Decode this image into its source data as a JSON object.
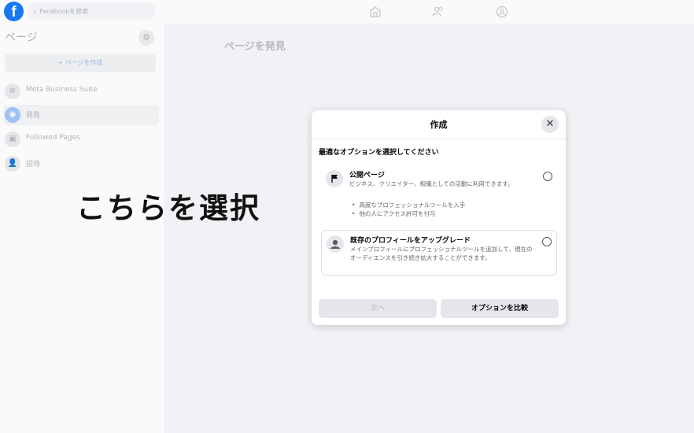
{
  "topbar": {
    "search_placeholder": "Facebookを検索"
  },
  "sidebar": {
    "title": "ページ",
    "create_label": "+ ページを作成",
    "items": [
      {
        "label": "Meta Business Suite",
        "icon": "meta-business-icon"
      },
      {
        "label": "発見",
        "icon": "compass-icon"
      },
      {
        "label": "Followed Pages",
        "icon": "like-icon"
      },
      {
        "label": "招待",
        "icon": "invite-icon"
      }
    ]
  },
  "main": {
    "title": "ページを発見"
  },
  "annotation": {
    "text": "こちらを選択"
  },
  "dialog": {
    "title": "作成",
    "close_icon": "close-icon",
    "subtitle": "最適なオプションを選択してください",
    "options": [
      {
        "title": "公開ページ",
        "description": "ビジネス、クリエイター、組織としての活動に利用できます。",
        "bullets": [
          "高度なプロフェッショナルツールを入手",
          "他の人にアクセス許可を付与"
        ],
        "icon": "flag-icon"
      },
      {
        "title": "既存のプロフィールをアップグレード",
        "description": "メインプロフィールにプロフェッショナルツールを追加して、現在のオーディエンスを引き続き拡大することができます。",
        "icon": "profile-icon"
      }
    ],
    "next_label": "次へ",
    "compare_label": "オプションを比較"
  },
  "colors": {
    "accent": "#1877f2",
    "highlight": "#3b82d6"
  }
}
